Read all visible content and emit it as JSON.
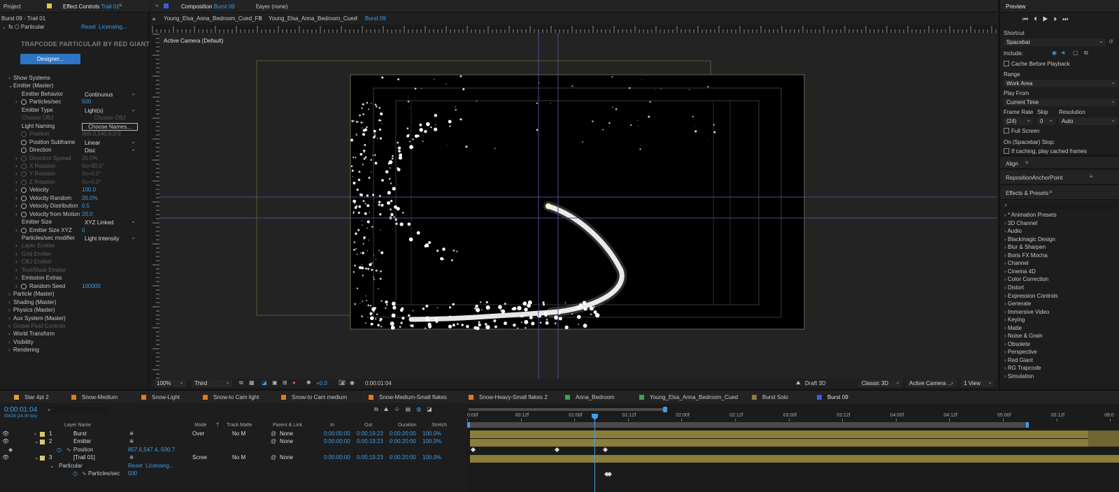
{
  "left": {
    "tab_project": "Project",
    "tab_effect": "Effect Controls",
    "tab_effect_layer": "Trail 01",
    "path": "Burst 09 - Trail 01",
    "effect_name": "Particular",
    "reset": "Reset",
    "licensing": "Licensing...",
    "brand": "TRAPCODE PARTICULAR BY RED GIANT",
    "designer": "Designer...",
    "props": [
      {
        "label": "Show Systems",
        "value": "",
        "indent": 0,
        "tw": "›",
        "kind": "text"
      },
      {
        "label": "Emitter (Master)",
        "value": "",
        "indent": 0,
        "tw": "⌄",
        "kind": "text"
      },
      {
        "label": "Emitter Behavior",
        "value": "Continuous",
        "indent": 1,
        "tw": "",
        "kind": "dd"
      },
      {
        "label": "Particles/sec",
        "value": "500",
        "indent": 1,
        "tw": "›",
        "kind": "num",
        "sw": true
      },
      {
        "label": "Emitter Type",
        "value": "Light(s)",
        "indent": 1,
        "tw": "",
        "kind": "dd"
      },
      {
        "label": "Choose OBJ",
        "value": "Choose OBJ",
        "indent": 1,
        "tw": "",
        "kind": "dimbtn",
        "dim": true
      },
      {
        "label": "Light Naming",
        "value": "Choose Names...",
        "indent": 1,
        "tw": "",
        "kind": "btn"
      },
      {
        "label": "Position",
        "value": "960.0,540.0,0.0",
        "indent": 1,
        "tw": "",
        "kind": "dimval",
        "dim": true,
        "sw": true
      },
      {
        "label": "Position Subframe",
        "value": "Linear",
        "indent": 1,
        "tw": "",
        "kind": "dd",
        "sw": true
      },
      {
        "label": "Direction",
        "value": "Disc",
        "indent": 1,
        "tw": "",
        "kind": "dd",
        "sw": true
      },
      {
        "label": "Direction Spread",
        "value": "20.0%",
        "indent": 1,
        "tw": "›",
        "kind": "dimval",
        "dim": true,
        "sw": true
      },
      {
        "label": "X Rotation",
        "value": "0x+90.0°",
        "indent": 1,
        "tw": "›",
        "kind": "dimval",
        "dim": true,
        "sw": true
      },
      {
        "label": "Y Rotation",
        "value": "0x+0.0°",
        "indent": 1,
        "tw": "›",
        "kind": "dimval",
        "dim": true,
        "sw": true
      },
      {
        "label": "Z Rotation",
        "value": "0x+0.0°",
        "indent": 1,
        "tw": "›",
        "kind": "dimval",
        "dim": true,
        "sw": true
      },
      {
        "label": "Velocity",
        "value": "100.0",
        "indent": 1,
        "tw": "›",
        "kind": "num",
        "sw": true
      },
      {
        "label": "Velocity Random",
        "value": "20.0%",
        "indent": 1,
        "tw": "›",
        "kind": "num",
        "sw": true
      },
      {
        "label": "Velocity Distribution",
        "value": "0.5",
        "indent": 1,
        "tw": "›",
        "kind": "num",
        "sw": true
      },
      {
        "label": "Velocity from Motion",
        "value": "20.0",
        "indent": 1,
        "tw": "›",
        "kind": "num",
        "sw": true
      },
      {
        "label": "Emitter Size",
        "value": "XYZ Linked",
        "indent": 1,
        "tw": "",
        "kind": "dd"
      },
      {
        "label": "Emitter Size XYZ",
        "value": "0",
        "indent": 1,
        "tw": "›",
        "kind": "num",
        "sw": true
      },
      {
        "label": "Particles/sec modifier",
        "value": "Light Intensity",
        "indent": 1,
        "tw": "",
        "kind": "dd"
      },
      {
        "label": "Layer Emitter",
        "value": "",
        "indent": 1,
        "tw": "›",
        "kind": "text",
        "dim": true
      },
      {
        "label": "Grid Emitter",
        "value": "",
        "indent": 1,
        "tw": "›",
        "kind": "text",
        "dim": true
      },
      {
        "label": "OBJ Emitter",
        "value": "",
        "indent": 1,
        "tw": "›",
        "kind": "text",
        "dim": true
      },
      {
        "label": "Text/Mask Emitter",
        "value": "",
        "indent": 1,
        "tw": "›",
        "kind": "text",
        "dim": true
      },
      {
        "label": "Emission Extras",
        "value": "",
        "indent": 1,
        "tw": "›",
        "kind": "text"
      },
      {
        "label": "Random Seed",
        "value": "100000",
        "indent": 1,
        "tw": "›",
        "kind": "num",
        "sw": true
      },
      {
        "label": "Particle (Master)",
        "value": "",
        "indent": 0,
        "tw": "›",
        "kind": "text"
      },
      {
        "label": "Shading (Master)",
        "value": "",
        "indent": 0,
        "tw": "›",
        "kind": "text"
      },
      {
        "label": "Physics (Master)",
        "value": "",
        "indent": 0,
        "tw": "›",
        "kind": "text"
      },
      {
        "label": "Aux System (Master)",
        "value": "",
        "indent": 0,
        "tw": "›",
        "kind": "text"
      },
      {
        "label": "Global Fluid Controls",
        "value": "",
        "indent": 0,
        "tw": "›",
        "kind": "text",
        "dim": true
      },
      {
        "label": "World Transform",
        "value": "",
        "indent": 0,
        "tw": "›",
        "kind": "text"
      },
      {
        "label": "Visibility",
        "value": "",
        "indent": 0,
        "tw": "›",
        "kind": "text"
      },
      {
        "label": "Rendering",
        "value": "",
        "indent": 0,
        "tw": "›",
        "kind": "text"
      }
    ]
  },
  "comp": {
    "tab_comp": "Composition",
    "tab_comp_name": "Burst 09",
    "tab_layer": "Layer (none)",
    "crumbs": [
      "Young_Elsa_Anna_Bedroom_Cued_FB",
      "Young_Elsa_Anna_Bedroom_Cued",
      "Burst 09"
    ],
    "camera_label": "Active Camera (Default)",
    "zoom": "100%",
    "resolution": "Third",
    "exposure": "+0.0",
    "timecode": "0:00:01:04",
    "renderer_mode": "Draft 3D",
    "renderer": "Classic 3D",
    "camera": "Active Camera ...",
    "views": "1 View"
  },
  "right": {
    "preview_title": "Preview",
    "shortcut_label": "Shortcut",
    "shortcut": "Spacebar",
    "include_label": "Include:",
    "cache": "Cache Before Playback",
    "range_label": "Range",
    "range": "Work Area",
    "play_from_label": "Play From",
    "play_from": "Current Time",
    "frame_rate_label": "Frame Rate",
    "skip_label": "Skip",
    "resolution_label": "Resolution",
    "frame_rate": "(24)",
    "skip": "0",
    "resolution": "Auto",
    "full_screen": "Full Screen",
    "on_stop": "On (Spacebar) Stop:",
    "if_caching": "If caching, play cached frames",
    "align": "Align",
    "reposition": "RepositionAnchorPoint",
    "effects_title": "Effects & Presets",
    "effects": [
      "* Animation Presets",
      "3D Channel",
      "Audio",
      "Blackmagic Design",
      "Blur & Sharpen",
      "Boris FX Mocha",
      "Channel",
      "Cinema 4D",
      "Color Correction",
      "Distort",
      "Expression Controls",
      "Generate",
      "Immersive Video",
      "Keying",
      "Matte",
      "Noise & Grain",
      "Obsolete",
      "Perspective",
      "Red Giant",
      "RG Trapcode",
      "Simulation"
    ]
  },
  "timeline": {
    "tabs": [
      {
        "label": "Star 4pt 2",
        "color": "#d8a23a"
      },
      {
        "label": "Snow-Medium",
        "color": "#e07a1e"
      },
      {
        "label": "Snow-Light",
        "color": "#e07a1e"
      },
      {
        "label": "Snow-to Cam light",
        "color": "#e07a1e"
      },
      {
        "label": "Snow-to Cam medium",
        "color": "#e07a1e"
      },
      {
        "label": "Snow-Medium-Small flakes",
        "color": "#e07a1e"
      },
      {
        "label": "Snow-Heavy-Small flakes 2",
        "color": "#e07a1e"
      },
      {
        "label": "Anna_Bedroom",
        "color": "#3aa05a"
      },
      {
        "label": "Young_Elsa_Anna_Bedroom_Cued",
        "color": "#3aa05a"
      },
      {
        "label": "Burst Solo",
        "color": "#8a7a4a"
      },
      {
        "label": "Burst 09",
        "color": "#3a5ed8"
      }
    ],
    "current_time": "0:00:01:04",
    "frame_info": "00028 (24.00 fps)",
    "col_headers": {
      "layer_name": "Layer Name",
      "mode": "Mode",
      "t": "T",
      "track_matte": "Track Matte",
      "parent": "Parent & Link",
      "in": "In",
      "out": "Out",
      "duration": "Duration",
      "stretch": "Stretch"
    },
    "ruler": [
      "0:00f",
      "00:12f",
      "01:00f",
      "01:12f",
      "02:00f",
      "02:12f",
      "03:00f",
      "03:12f",
      "04:00f",
      "04:12f",
      "05:00f",
      "05:12f",
      "06:0"
    ],
    "layers": [
      {
        "num": "1",
        "name": "Burst",
        "color": "#d8c870",
        "mode": "Over",
        "matte": "No M",
        "parent": "None",
        "in": "0:00:00:00",
        "out": "0:00:19:23",
        "duration": "0:00:20:00",
        "stretch": "100.0%"
      },
      {
        "num": "2",
        "name": "Emitter",
        "color": "#d8c870",
        "mode": "",
        "matte": "",
        "parent": "None",
        "in": "0:00:00:00",
        "out": "0:00:19:23",
        "duration": "0:00:20:00",
        "stretch": "100.0%"
      },
      {
        "num": "3",
        "name": "[Trail 01]",
        "color": "#d8c870",
        "mode": "Scree",
        "matte": "No M",
        "parent": "None",
        "in": "0:00:00:00",
        "out": "0:00:19:23",
        "duration": "0:00:20:00",
        "stretch": "100.0%"
      }
    ],
    "position_label": "Position",
    "position_value": "857.6,547.4,-500.7",
    "particular_label": "Particular",
    "reset": "Reset",
    "licensing": "Licensing...",
    "particles_label": "Particles/sec",
    "particles_value": "500"
  }
}
